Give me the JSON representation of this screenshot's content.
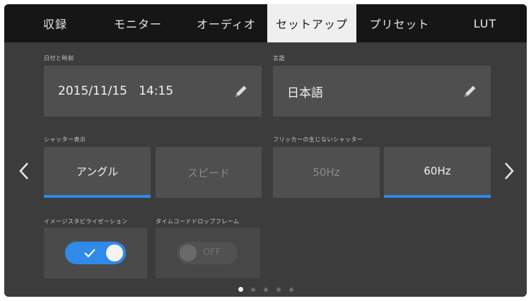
{
  "tabs": [
    {
      "label": "収録",
      "active": false
    },
    {
      "label": "モニター",
      "active": false
    },
    {
      "label": "オーディオ",
      "active": false
    },
    {
      "label": "セットアップ",
      "active": true
    },
    {
      "label": "プリセット",
      "active": false
    },
    {
      "label": "LUT",
      "active": false
    }
  ],
  "datetime": {
    "label": "日付と時刻",
    "value": "2015/11/15   14:15",
    "icon": "pencil-icon"
  },
  "language": {
    "label": "言語",
    "value": "日本語",
    "icon": "pencil-icon"
  },
  "shutter_display": {
    "label": "シャッター表示",
    "options": [
      "アングル",
      "スピード"
    ],
    "selected": "アングル"
  },
  "flicker_free_shutter": {
    "label": "フリッカーの生じないシャッター",
    "options": [
      "50Hz",
      "60Hz"
    ],
    "selected": "60Hz"
  },
  "image_stabilization": {
    "label": "イメージスタビライゼーション",
    "state": "on"
  },
  "timecode_drop_frame": {
    "label": "タイムコードドロップフレーム",
    "state_text": "OFF"
  },
  "pagination": {
    "total": 5,
    "current": 1
  },
  "colors": {
    "accent": "#2f8ae8",
    "background": "#3c3c3c",
    "tabbar": "#161616"
  }
}
